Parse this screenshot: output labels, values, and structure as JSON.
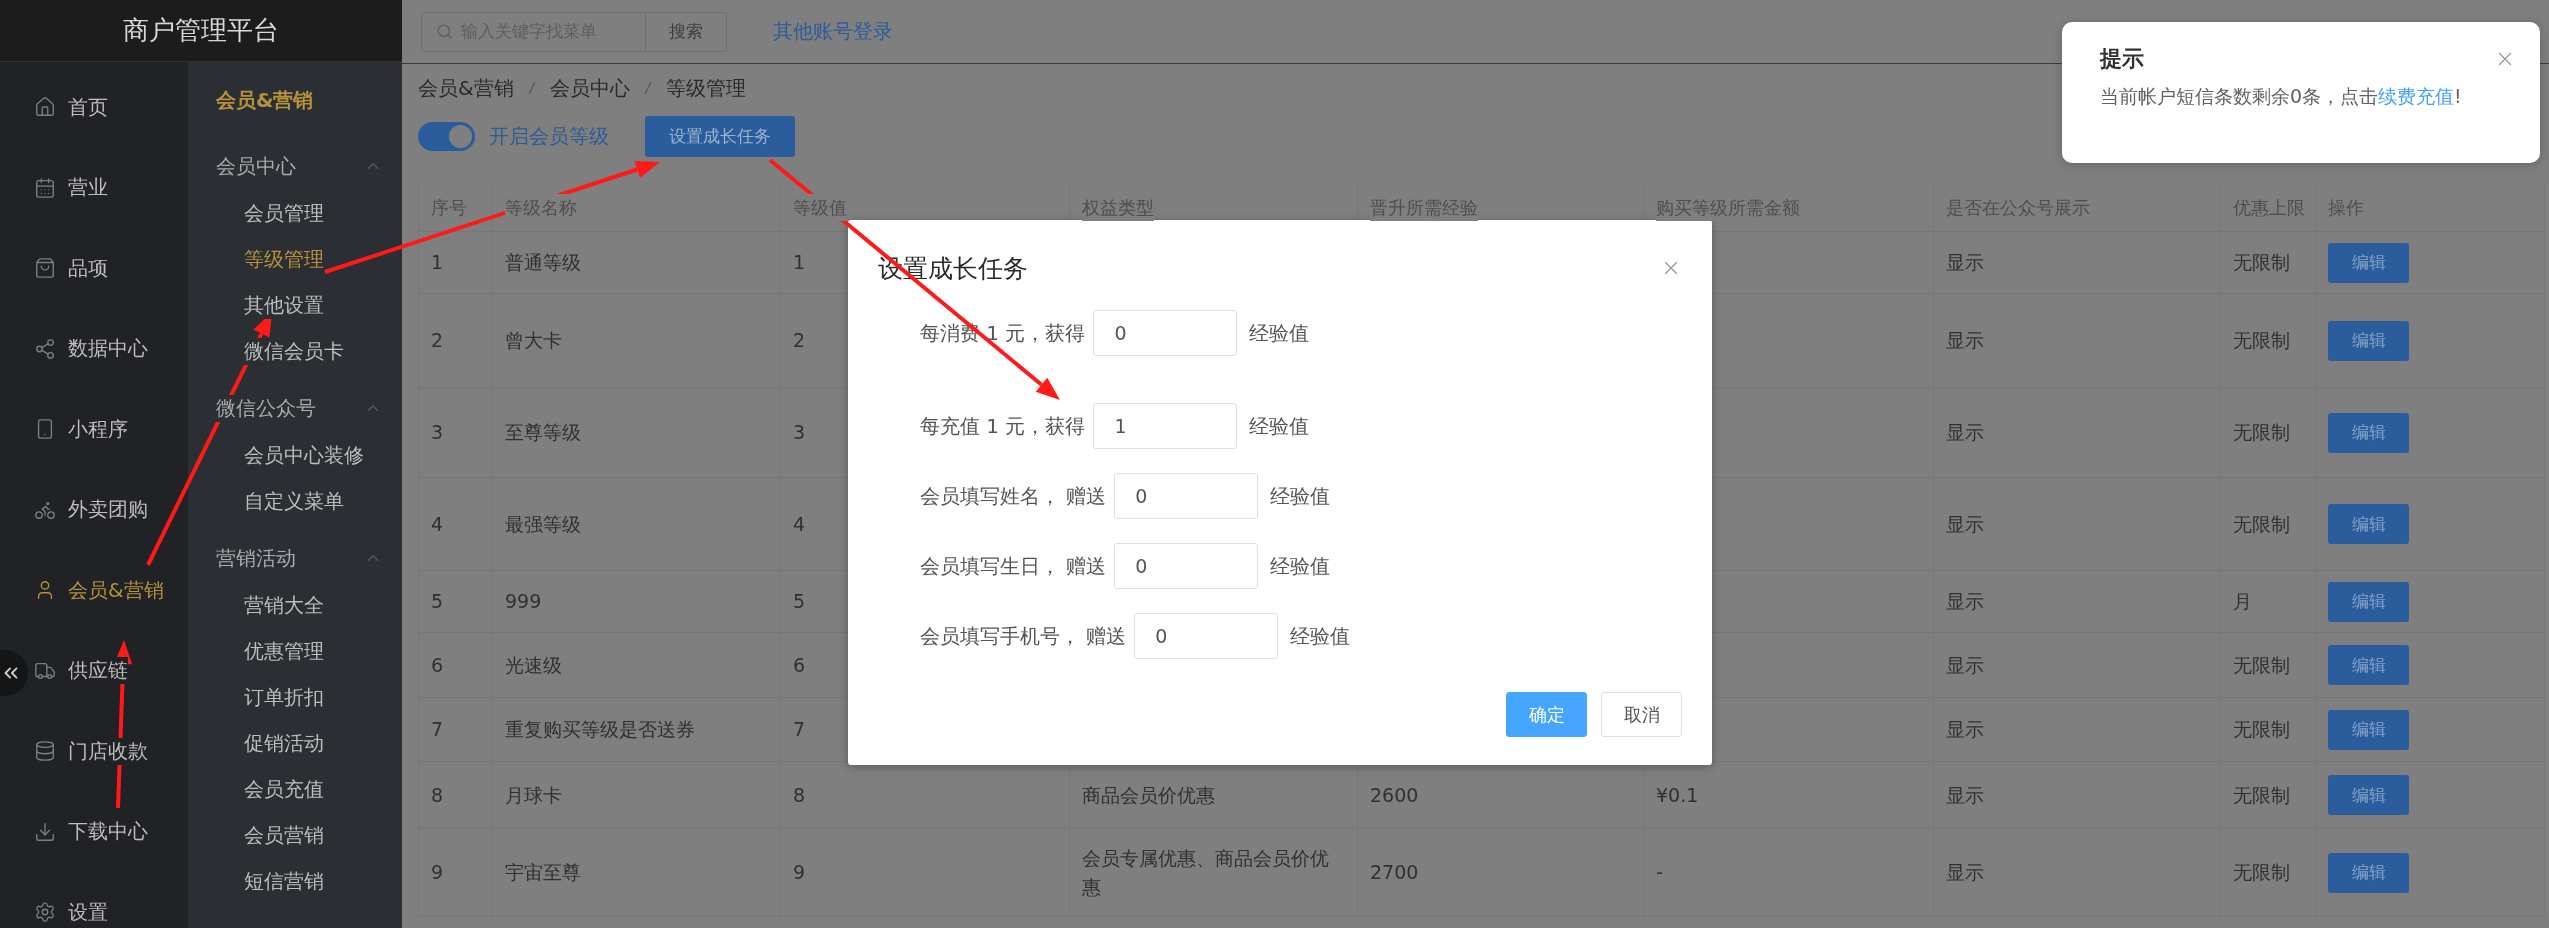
{
  "brand": "商户管理平台",
  "nav": [
    {
      "label": "首页",
      "selected": false
    },
    {
      "label": "营业",
      "selected": false
    },
    {
      "label": "品项",
      "selected": false
    },
    {
      "label": "数据中心",
      "selected": false
    },
    {
      "label": "小程序",
      "selected": false
    },
    {
      "label": "外卖团购",
      "selected": false
    },
    {
      "label": "会员&营销",
      "selected": true
    },
    {
      "label": "供应链",
      "selected": false
    },
    {
      "label": "门店收款",
      "selected": false
    },
    {
      "label": "下载中心",
      "selected": false
    },
    {
      "label": "设置",
      "selected": false
    }
  ],
  "subnav": {
    "title": "会员&营销",
    "groups": [
      {
        "label": "会员中心",
        "expanded": true,
        "children": [
          {
            "label": "会员管理",
            "selected": false
          },
          {
            "label": "等级管理",
            "selected": true
          },
          {
            "label": "其他设置",
            "selected": false
          },
          {
            "label": "微信会员卡",
            "selected": false
          }
        ]
      },
      {
        "label": "微信公众号",
        "expanded": true,
        "children": [
          {
            "label": "会员中心装修",
            "selected": false
          },
          {
            "label": "自定义菜单",
            "selected": false
          }
        ]
      },
      {
        "label": "营销活动",
        "expanded": true,
        "children": [
          {
            "label": "营销大全",
            "selected": false
          },
          {
            "label": "优惠管理",
            "selected": false
          },
          {
            "label": "订单折扣",
            "selected": false
          },
          {
            "label": "促销活动",
            "selected": false
          },
          {
            "label": "会员充值",
            "selected": false
          },
          {
            "label": "会员营销",
            "selected": false
          },
          {
            "label": "短信营销",
            "selected": false
          }
        ]
      }
    ]
  },
  "topbar": {
    "search": {
      "placeholder": "输入关键字找菜单",
      "button": "搜索"
    },
    "link": "其他账号登录"
  },
  "breadcrumb": [
    "会员&营销",
    "会员中心",
    "等级管理"
  ],
  "toolbar": {
    "toggle": {
      "label": "开启会员等级",
      "on": true
    },
    "button": "设置成长任务"
  },
  "table": {
    "columns": [
      "序号",
      "等级名称",
      "等级值",
      "权益类型",
      "晋升所需经验",
      "购买等级所需金额",
      "是否在公众号展示",
      "优惠上限",
      "操作"
    ],
    "rows": [
      {
        "no": "1",
        "name": "普通等级",
        "value": "1",
        "show": "显示",
        "limit": "无限制",
        "action": "编辑"
      },
      {
        "no": "2",
        "name": "曾大卡",
        "value": "2",
        "show": "显示",
        "limit": "无限制",
        "action": "编辑"
      },
      {
        "no": "3",
        "name": "至尊等级",
        "value": "3",
        "show": "显示",
        "limit": "无限制",
        "action": "编辑"
      },
      {
        "no": "4",
        "name": "最强等级",
        "value": "4",
        "show": "显示",
        "limit": "无限制",
        "action": "编辑"
      },
      {
        "no": "5",
        "name": "999",
        "value": "5",
        "show": "显示",
        "limit": "月",
        "action": "编辑"
      },
      {
        "no": "6",
        "name": "光速级",
        "value": "6",
        "show": "显示",
        "limit": "无限制",
        "action": "编辑"
      },
      {
        "no": "7",
        "name": "重复购买等级是否送券",
        "value": "7",
        "show": "显示",
        "limit": "无限制",
        "action": "编辑"
      },
      {
        "no": "8",
        "name": "月球卡",
        "value": "8",
        "benefit": "商品会员价优惠",
        "exp": "2600",
        "price": "¥0.1",
        "show": "显示",
        "limit": "无限制",
        "action": "编辑"
      },
      {
        "no": "9",
        "name": "宇宙至尊",
        "value": "9",
        "benefit": "会员专属优惠、商品会员价优惠",
        "exp": "2700",
        "price": "-",
        "show": "显示",
        "limit": "无限制",
        "action": "编辑"
      }
    ]
  },
  "dialog": {
    "title": "设置成长任务",
    "fields": [
      {
        "label": "每消费 1 元，获得",
        "value": "0",
        "unit": "经验值"
      },
      {
        "label": "每充值 1 元，获得",
        "value": "1",
        "unit": "经验值"
      },
      {
        "label": "会员填写姓名， 赠送",
        "value": "0",
        "unit": "经验值"
      },
      {
        "label": "会员填写生日， 赠送",
        "value": "0",
        "unit": "经验值"
      },
      {
        "label": "会员填写手机号， 赠送",
        "value": "0",
        "unit": "经验值"
      }
    ],
    "buttons": [
      {
        "label": "确定",
        "kind": "primary"
      },
      {
        "label": "取消",
        "kind": "default"
      }
    ]
  },
  "toast": {
    "title": "提示",
    "message": "当前帐户短信条数剩余0条，点击",
    "link": "续费充值",
    "suffix": "!"
  }
}
